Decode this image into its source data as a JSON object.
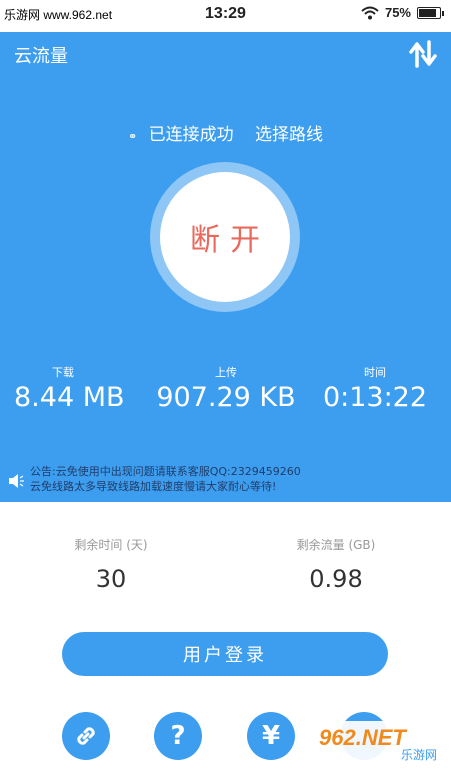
{
  "statusbar": {
    "carrier": "乐游网 www.962.net",
    "time": "13:29",
    "battery": "75%"
  },
  "header": {
    "title": "云流量",
    "switch_icon": "switch-arrows-icon"
  },
  "connection": {
    "status": "已连接成功",
    "route_label": "选择路线",
    "button_label": "断开"
  },
  "stats": {
    "download": {
      "label": "下载",
      "value": "8.44 MB"
    },
    "upload": {
      "label": "上传",
      "value": "907.29 KB"
    },
    "time": {
      "label": "时间",
      "value": "0:13:22"
    }
  },
  "notice": {
    "line1": "公告:云免使用中出现问题请联系客服QQ:2329459260",
    "line2": "云免线路太多导致线路加载速度慢请大家耐心等待!"
  },
  "remaining": {
    "time": {
      "label": "剩余时间 (天)",
      "value": "30"
    },
    "flow": {
      "label": "剩余流量 (GB)",
      "value": "0.98"
    }
  },
  "login": {
    "label": "用户登录"
  },
  "bottom_icons": [
    "link-icon",
    "help-icon",
    "yen-icon",
    "more-icon"
  ],
  "watermark": {
    "main": "962.NET",
    "sub": "乐游网"
  },
  "colors": {
    "primary": "#3d9ef0",
    "disconnect_text": "#e86a5c",
    "notice_text": "#1f3d6a"
  }
}
